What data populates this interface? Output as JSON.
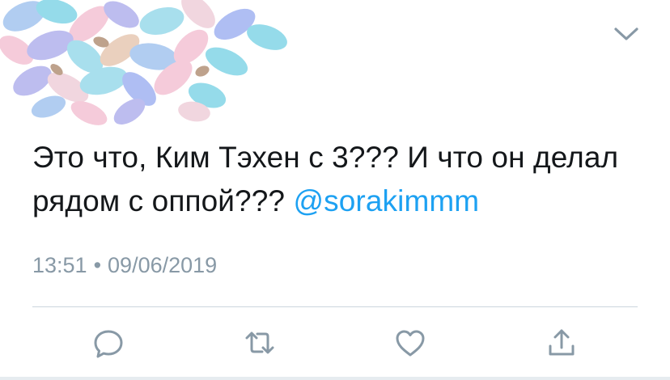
{
  "header": {
    "banner_image": "flower-petals-illustration",
    "menu_icon": "chevron-down-icon"
  },
  "tweet": {
    "text": "Это что, Ким Тэхен с 3??? И что он делал рядом с оппой???",
    "mention": "@sorakimmm",
    "time": "13:51",
    "separator": "•",
    "date": "09/06/2019"
  },
  "actions": [
    {
      "icon": "reply-icon"
    },
    {
      "icon": "retweet-icon"
    },
    {
      "icon": "like-icon"
    },
    {
      "icon": "share-icon"
    }
  ],
  "colors": {
    "text": "#14171a",
    "secondary": "#8899a6",
    "link": "#1da1f2",
    "divider": "#ccd6dd"
  }
}
